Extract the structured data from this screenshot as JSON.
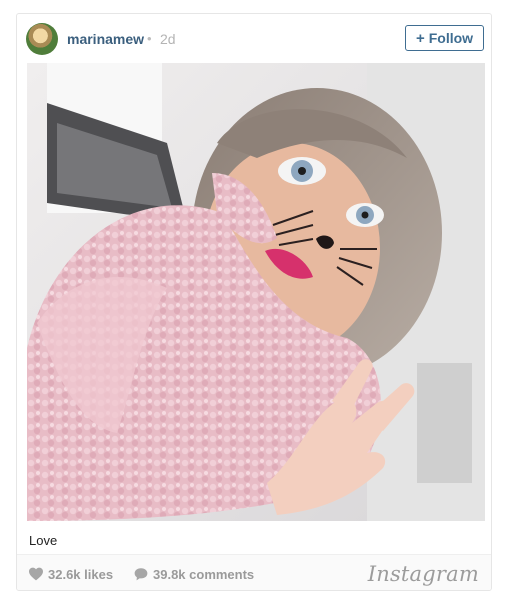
{
  "header": {
    "username": "marinamew",
    "separator": "•",
    "time_ago": "2d",
    "follow_plus": "+",
    "follow_label": "Follow"
  },
  "post": {
    "caption": "Love"
  },
  "footer": {
    "likes": "32.6k likes",
    "comments": "39.8k comments",
    "brand": "Instagram"
  },
  "icons": {
    "likes": "heart-icon",
    "comments": "speech-bubble-icon"
  },
  "colors": {
    "username": "#3b5f7e",
    "follow": "#3f6d91",
    "meta_text": "#9a9a9a"
  }
}
